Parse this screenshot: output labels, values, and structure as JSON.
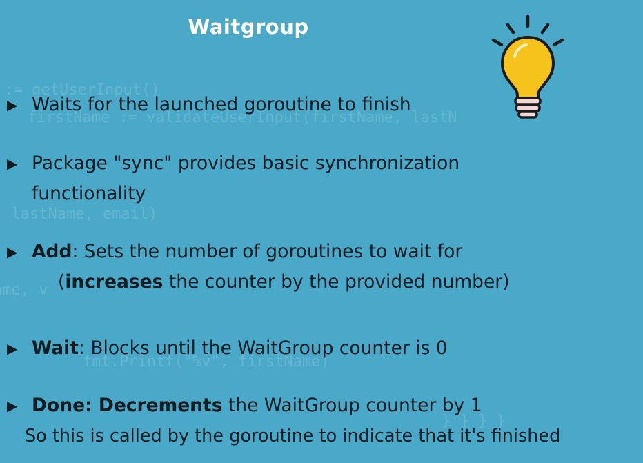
{
  "slide": {
    "title": "Waitgroup",
    "background_color": "#4aa8c8",
    "text_color": "#111d22",
    "title_color": "#ffffff"
  },
  "icon": {
    "name": "lightbulb-icon",
    "bulb_color": "#f6c21c",
    "outline_color": "#1c1c1c",
    "base_color": "#f3d7d9"
  },
  "bullets": [
    {
      "text": "Waits for the launched goroutine to finish"
    },
    {
      "line1": "Package \"sync\" provides basic synchronization",
      "line2": "functionality"
    },
    {
      "term": "Add",
      "rest": ": Sets the number of goroutines to wait for",
      "line2_open": "(",
      "line2_bold": "increases",
      "line2_rest": " the counter by the provided number)"
    },
    {
      "term": "Wait",
      "rest": ": Blocks until the WaitGroup counter is 0"
    },
    {
      "term": "Done: Decrements",
      "rest": " the WaitGroup counter by 1",
      "line2": "So this is called by the goroutine to indicate that it's finished"
    }
  ]
}
